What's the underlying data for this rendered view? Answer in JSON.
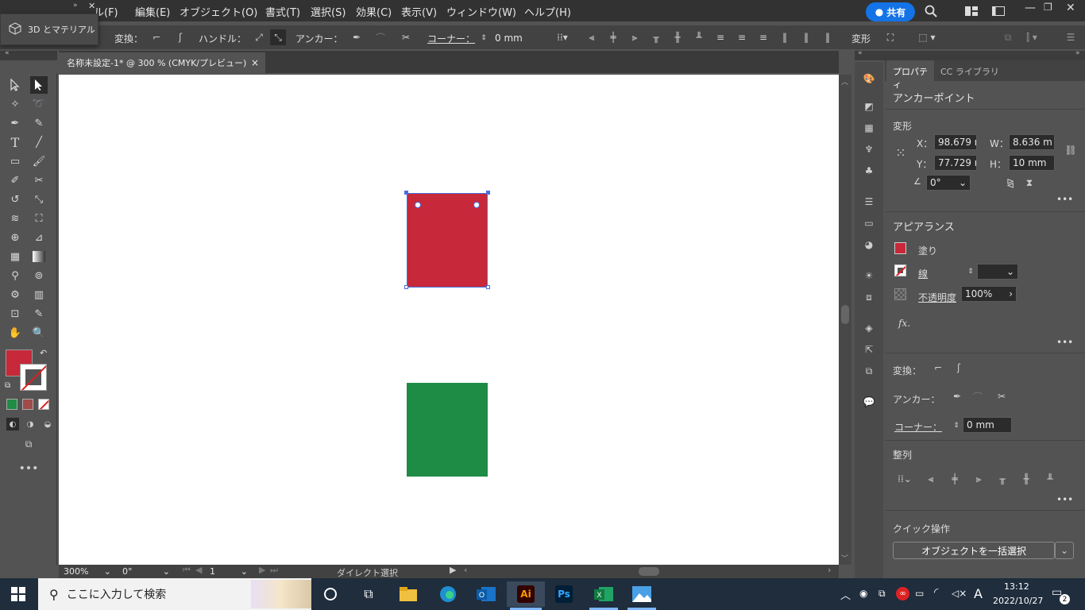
{
  "menubar": {
    "items": [
      "ル(F)",
      "編集(E)",
      "オブジェクト(O)",
      "書式(T)",
      "選択(S)",
      "効果(C)",
      "表示(V)",
      "ウィンドウ(W)",
      "ヘルプ(H)"
    ],
    "share_label": "共有"
  },
  "popup": {
    "label": "3D とマテリアル"
  },
  "control_bar": {
    "transform_label": "変換：",
    "handle_label": "ハンドル：",
    "anchor_label": "アンカー：",
    "corner_label": "コーナー：",
    "corner_value": "0 mm",
    "transform2_label": "変形"
  },
  "document_tab": {
    "title": "名称未設定-1* @ 300 % (CMYK/プレビュー)",
    "close": "×"
  },
  "status_bar": {
    "zoom": "300%",
    "rotate": "0°",
    "artboard": "1",
    "tool_name": "ダイレクト選択"
  },
  "properties_panel": {
    "tabs": [
      "プロパティ",
      "CC ライブラリ"
    ],
    "selection_type": "アンカーポイント",
    "transform": {
      "title": "変形",
      "x_label": "X：",
      "x_value": "98.679 r",
      "y_label": "Y：",
      "y_value": "77.729 r",
      "w_label": "W：",
      "w_value": "8.636 m",
      "h_label": "H：",
      "h_value": "10 mm",
      "angle_value": "0°"
    },
    "appearance": {
      "title": "アピアランス",
      "fill_label": "塗り",
      "stroke_label": "線",
      "opacity_label": "不透明度",
      "opacity_value": "100%",
      "fx_label": "fx."
    },
    "transform2": {
      "label": "変換："
    },
    "anchor": {
      "label": "アンカー："
    },
    "corner": {
      "label": "コーナー：",
      "value": "0 mm"
    },
    "align": {
      "title": "整列"
    },
    "quick_actions": {
      "title": "クイック操作",
      "button": "オブジェクトを一括選択"
    }
  },
  "colors": {
    "fill": "#c7283a",
    "green_rect": "#1e8c45",
    "selection": "#4a6fdc",
    "accent": "#1473e6"
  },
  "taskbar": {
    "search_placeholder": "ここに入力して検索",
    "time": "13:12",
    "date": "2022/10/27",
    "ime": "A",
    "notification_count": "2",
    "apps": [
      "task-view",
      "file-explorer",
      "edge",
      "outlook",
      "illustrator",
      "photoshop",
      "excel",
      "photos"
    ],
    "ai_label": "Ai",
    "ps_label": "Ps"
  }
}
